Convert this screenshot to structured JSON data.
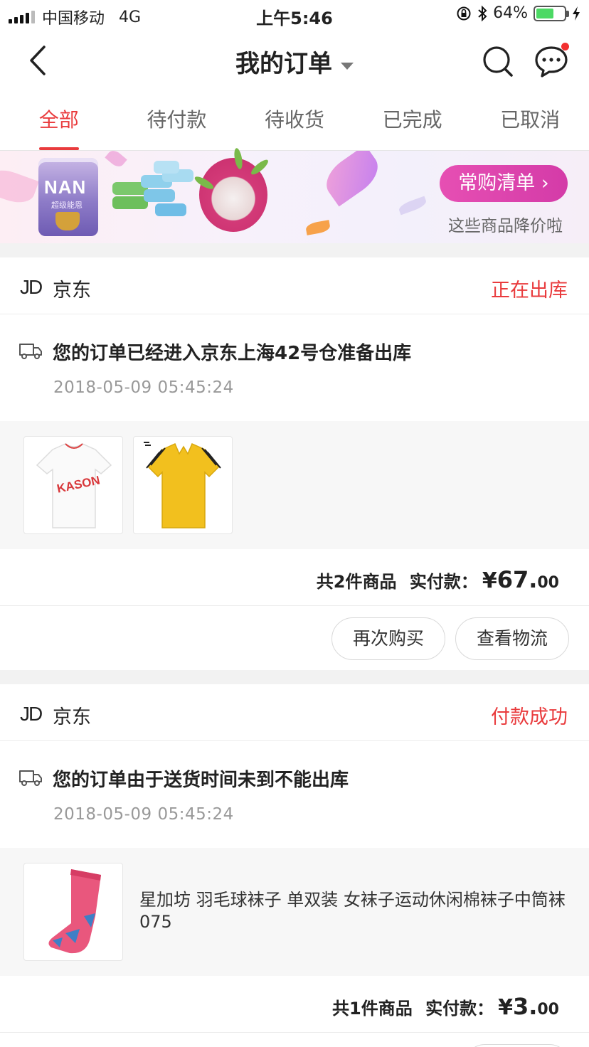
{
  "status_bar": {
    "carrier": "中国移动",
    "network": "4G",
    "time": "上午5:46",
    "battery": "64%",
    "battery_level": 0.64
  },
  "navbar": {
    "title": "我的订单"
  },
  "tabs": [
    {
      "label": "全部",
      "active": true
    },
    {
      "label": "待付款",
      "active": false
    },
    {
      "label": "待收货",
      "active": false
    },
    {
      "label": "已完成",
      "active": false
    },
    {
      "label": "已取消",
      "active": false
    }
  ],
  "banner": {
    "can_brand": "NAN",
    "can_sub": "超级能恩",
    "button_label": "常购清单 ›",
    "subtitle": "这些商品降价啦"
  },
  "orders": [
    {
      "shop_logo": "JD",
      "shop": "京东",
      "status": "正在出库",
      "logistics_text": "您的订单已经进入京东上海42号仓准备出库",
      "logistics_time": "2018-05-09 05:45:24",
      "summary_count": "共2件商品",
      "summary_paid_label": "实付款：",
      "currency": "¥",
      "price_int": "67.",
      "price_dec": "00",
      "buttons": [
        "再次购买",
        "查看物流"
      ],
      "tshirt_text": "KASON"
    },
    {
      "shop_logo": "JD",
      "shop": "京东",
      "status": "付款成功",
      "logistics_text": "您的订单由于送货时间未到不能出库",
      "logistics_time": "2018-05-09 05:45:24",
      "goods_title": "星加坊 羽毛球袜子 单双装 女袜子运动休闲棉袜子中筒袜 075",
      "summary_count": "共1件商品",
      "summary_paid_label": "实付款：",
      "currency": "¥",
      "price_int": "3.",
      "price_dec": "00"
    }
  ],
  "colors": {
    "accent": "#e93b3d",
    "banner_button": "#d43ba8",
    "battery": "#4cd964"
  }
}
